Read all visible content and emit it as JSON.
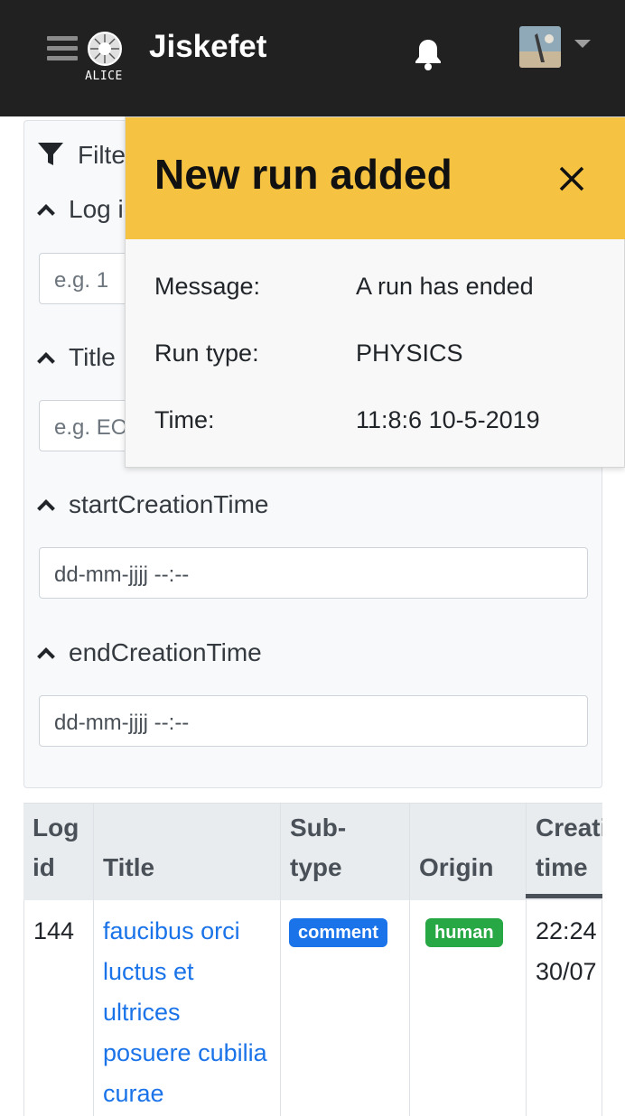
{
  "navbar": {
    "brand": "Jiskefet",
    "logo_text": "ALICE",
    "icons": [
      "hamburger-icon",
      "bell-icon",
      "caret-down-icon"
    ]
  },
  "filters": {
    "title": "Filter",
    "sections": [
      {
        "label": "Log id",
        "placeholder": "e.g. 1"
      },
      {
        "label": "Title",
        "placeholder": "e.g. EOR"
      },
      {
        "label": "startCreationTime",
        "placeholder": "dd-mm-jjjj --:--"
      },
      {
        "label": "endCreationTime",
        "placeholder": "dd-mm-jjjj --:--"
      }
    ]
  },
  "toast": {
    "title": "New run added",
    "message_label": "Message:",
    "message_value": "A run has ended",
    "runtype_label": "Run type:",
    "runtype_value": "PHYSICS",
    "time_label": "Time:",
    "time_value": "11:8:6 10-5-2019"
  },
  "table": {
    "headers": [
      "Log id",
      "Title",
      "Sub-type",
      "Origin",
      "Creation time"
    ],
    "rows": [
      {
        "id": "144",
        "title": "faucibus orci luctus et ultrices posuere cubilia curae",
        "subtype": "comment",
        "origin": "human",
        "time": "22:24 30/07"
      }
    ]
  },
  "colors": {
    "navbar": "#212121",
    "toast_header": "#f5c242",
    "badge_comment": "#1a73e8",
    "badge_human": "#28a745",
    "link": "#1a73e8"
  }
}
